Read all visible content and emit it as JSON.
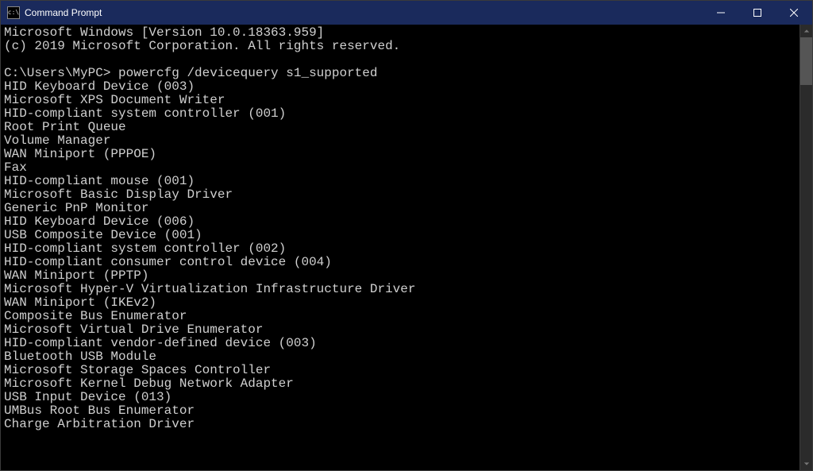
{
  "window": {
    "title": "Command Prompt",
    "icon_glyph": "c:\\"
  },
  "terminal": {
    "header_line": "Microsoft Windows [Version 10.0.18363.959]",
    "copyright_line": "(c) 2019 Microsoft Corporation. All rights reserved.",
    "prompt": "C:\\Users\\MyPC>",
    "command": "powercfg /devicequery s1_supported",
    "output_lines": [
      "HID Keyboard Device (003)",
      "Microsoft XPS Document Writer",
      "HID-compliant system controller (001)",
      "Root Print Queue",
      "Volume Manager",
      "WAN Miniport (PPPOE)",
      "Fax",
      "HID-compliant mouse (001)",
      "Microsoft Basic Display Driver",
      "Generic PnP Monitor",
      "HID Keyboard Device (006)",
      "USB Composite Device (001)",
      "HID-compliant system controller (002)",
      "HID-compliant consumer control device (004)",
      "WAN Miniport (PPTP)",
      "Microsoft Hyper-V Virtualization Infrastructure Driver",
      "WAN Miniport (IKEv2)",
      "Composite Bus Enumerator",
      "Microsoft Virtual Drive Enumerator",
      "HID-compliant vendor-defined device (003)",
      "Bluetooth USB Module",
      "Microsoft Storage Spaces Controller",
      "Microsoft Kernel Debug Network Adapter",
      "USB Input Device (013)",
      "UMBus Root Bus Enumerator",
      "Charge Arbitration Driver"
    ]
  }
}
